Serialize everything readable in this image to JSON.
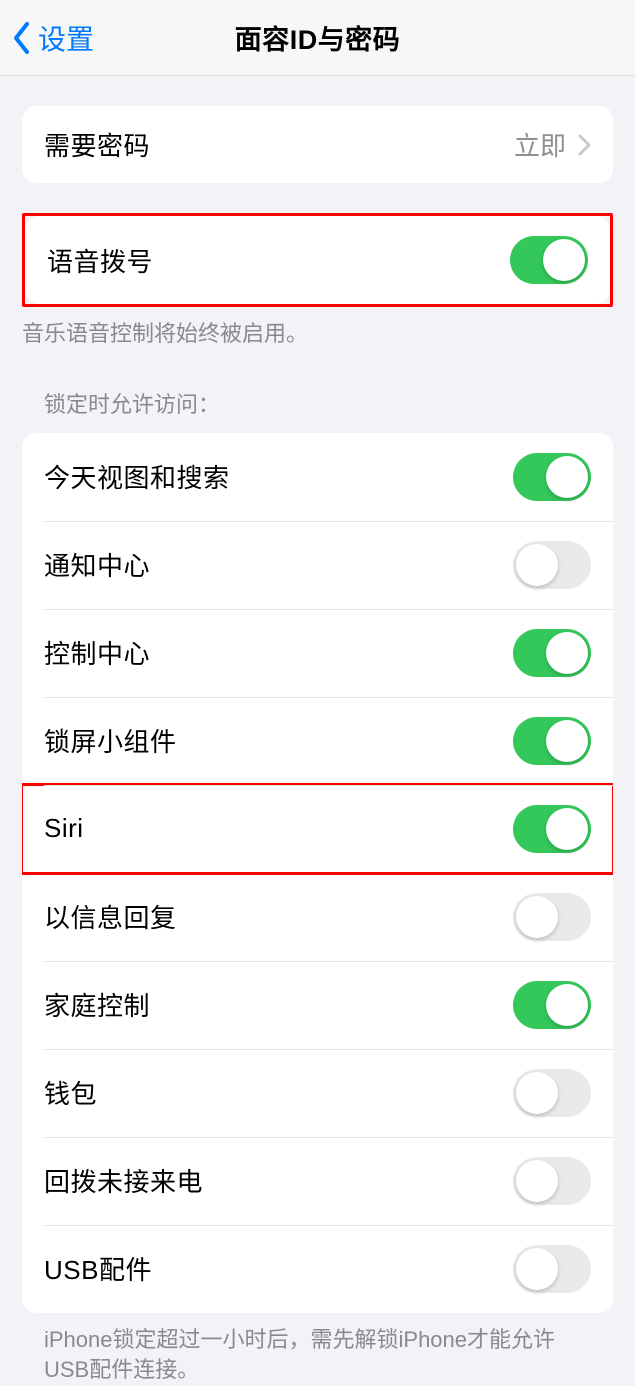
{
  "nav": {
    "back_label": "设置",
    "title": "面容ID与密码"
  },
  "passcode": {
    "label": "需要密码",
    "value": "立即"
  },
  "voice_dial": {
    "label": "语音拨号",
    "footer": "音乐语音控制将始终被启用。"
  },
  "lock_access": {
    "header": "锁定时允许访问：",
    "items": [
      {
        "label": "今天视图和搜索",
        "on": true
      },
      {
        "label": "通知中心",
        "on": false
      },
      {
        "label": "控制中心",
        "on": true
      },
      {
        "label": "锁屏小组件",
        "on": true
      },
      {
        "label": "Siri",
        "on": true
      },
      {
        "label": "以信息回复",
        "on": false
      },
      {
        "label": "家庭控制",
        "on": true
      },
      {
        "label": "钱包",
        "on": false
      },
      {
        "label": "回拨未接来电",
        "on": false
      },
      {
        "label": "USB配件",
        "on": false
      }
    ],
    "footer": "iPhone锁定超过一小时后，需先解锁iPhone才能允许USB配件连接。"
  }
}
